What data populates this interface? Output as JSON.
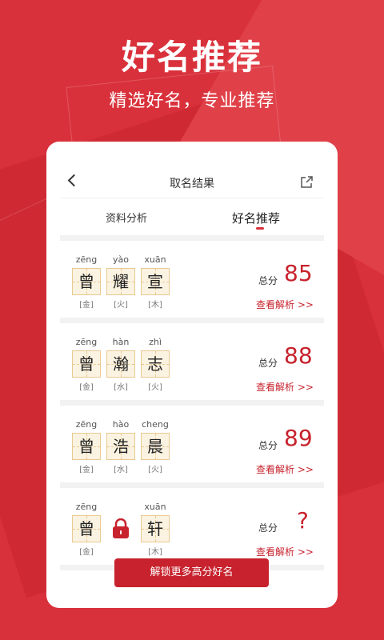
{
  "hero": {
    "title": "好名推荐",
    "subtitle": "精选好名，专业推荐"
  },
  "header": {
    "title": "取名结果",
    "back_icon": "chevron-left-icon",
    "share_icon": "share-icon"
  },
  "tabs": [
    {
      "label": "资料分析",
      "active": false
    },
    {
      "label": "好名推荐",
      "active": true
    }
  ],
  "names": [
    {
      "chars": [
        {
          "pinyin": "zēng",
          "char": "曾",
          "element": "[金]"
        },
        {
          "pinyin": "yào",
          "char": "耀",
          "element": "[火]"
        },
        {
          "pinyin": "xuān",
          "char": "宣",
          "element": "[木]"
        }
      ],
      "score_label": "总分",
      "score": "85",
      "link": "查看解析 >>"
    },
    {
      "chars": [
        {
          "pinyin": "zēng",
          "char": "曾",
          "element": "[金]"
        },
        {
          "pinyin": "hàn",
          "char": "瀚",
          "element": "[水]"
        },
        {
          "pinyin": "zhì",
          "char": "志",
          "element": "[火]"
        }
      ],
      "score_label": "总分",
      "score": "88",
      "link": "查看解析 >>"
    },
    {
      "chars": [
        {
          "pinyin": "zēng",
          "char": "曾",
          "element": "[金]"
        },
        {
          "pinyin": "hào",
          "char": "浩",
          "element": "[水]"
        },
        {
          "pinyin": "cheng",
          "char": "晨",
          "element": "[火]"
        }
      ],
      "score_label": "总分",
      "score": "89",
      "link": "查看解析 >>"
    },
    {
      "chars": [
        {
          "pinyin": "zēng",
          "char": "曾",
          "element": "[金]"
        },
        {
          "locked": true,
          "icon": "lock-icon"
        },
        {
          "pinyin": "xuān",
          "char": "轩",
          "element": "[木]"
        }
      ],
      "score_label": "总分",
      "score": "?",
      "link": "查看解析 >>"
    }
  ],
  "unlock_button": "解锁更多高分好名",
  "colors": {
    "brand": "#d9313b",
    "accent": "#c7222d",
    "box_bg": "#fbf3e2"
  }
}
